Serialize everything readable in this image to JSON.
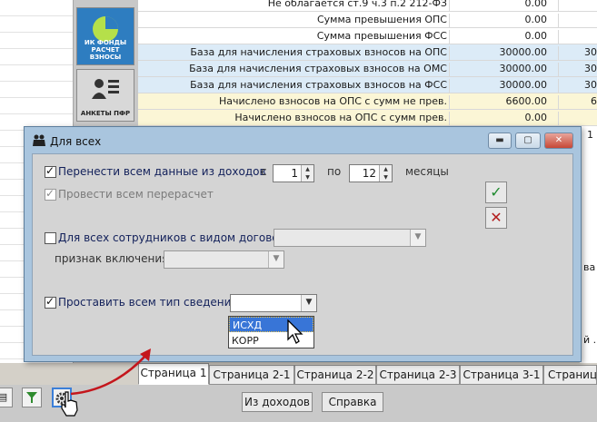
{
  "side_panel": {
    "btn_ik_label": "ИК ФОНДЫ РАСЧЕТ ВЗНОСЫ",
    "btn_ank_label": "АНКЕТЫ ПФР"
  },
  "bg_table": {
    "rows": [
      {
        "label": "Не облагается ст.9 ч.3 п.2 212-ФЗ",
        "v1": "0.00",
        "v2": ""
      },
      {
        "label": "Сумма превышения ОПС",
        "v1": "0.00",
        "v2": ""
      },
      {
        "label": "Сумма превышения ФСС",
        "v1": "0.00",
        "v2": ""
      },
      {
        "label": "База для начисления страховых взносов на ОПС",
        "v1": "30000.00",
        "v2": "30"
      },
      {
        "label": "База для начисления страховых взносов на ОМС",
        "v1": "30000.00",
        "v2": "30"
      },
      {
        "label": "База для начисления страховых взносов на ФСС",
        "v1": "30000.00",
        "v2": "30"
      },
      {
        "label": "Начислено взносов на ОПС с сумм не прев.",
        "v1": "6600.00",
        "v2": "6"
      },
      {
        "label": "Начислено взносов на ОПС с сумм прев.",
        "v1": "0.00",
        "v2": ""
      }
    ],
    "right_fragments": [
      "1",
      "ва",
      "й ."
    ]
  },
  "dialog": {
    "title": "Для всех",
    "row1": {
      "label": "Перенести всем данные из доходов",
      "from_label": "с",
      "from_value": "1",
      "to_label": "по",
      "to_value": "12",
      "unit": "месяцы"
    },
    "row2": {
      "label": "Провести всем перерасчет"
    },
    "row3": {
      "label": "Для всех сотрудников с видом договора",
      "sub_label": "признак включения"
    },
    "row4": {
      "label": "Проставить всем тип сведений"
    },
    "dropdown_options": [
      "ИСХД",
      "КОРР"
    ],
    "selected_option": "ИСХД"
  },
  "tabs": [
    "Страница 1",
    "Страница 2-1",
    "Страница 2-2",
    "Страница 2-3",
    "Страница 3-1",
    "Страница"
  ],
  "bottom_buttons": {
    "from_income": "Из доходов",
    "help": "Справка"
  },
  "colors": {
    "dialog_frame": "#a9c5de",
    "selection": "#3875d7",
    "ok_green": "#1e8a2e",
    "cancel_red": "#b31e1e",
    "arrow_red": "#c4161c"
  }
}
